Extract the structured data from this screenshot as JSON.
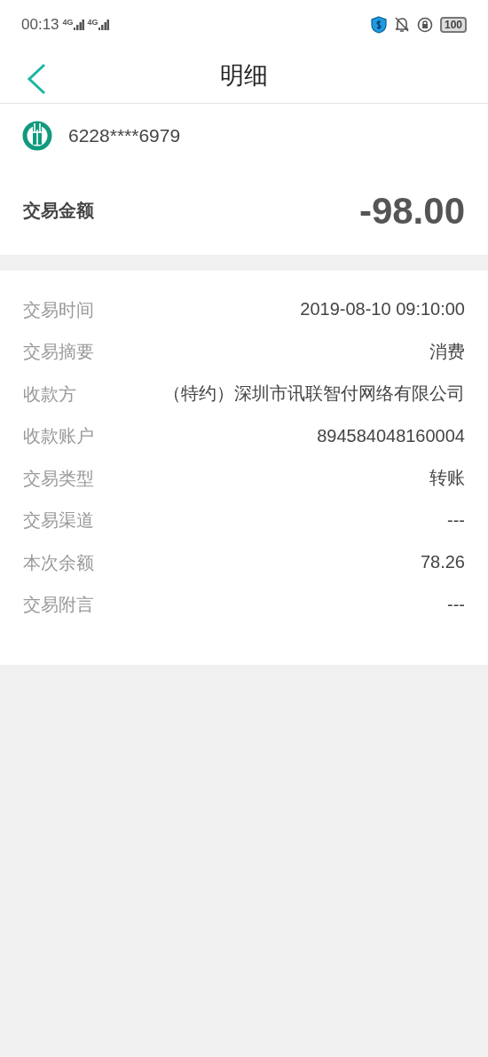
{
  "status_bar": {
    "time": "00:13",
    "signals": [
      "4G",
      "4G"
    ],
    "battery": "100"
  },
  "header": {
    "title": "明细"
  },
  "card": {
    "number": "6228****6979"
  },
  "amount": {
    "label": "交易金额",
    "value": "-98.00"
  },
  "details": [
    {
      "label": "交易时间",
      "value": "2019-08-10 09:10:00"
    },
    {
      "label": "交易摘要",
      "value": "消费"
    },
    {
      "label": "收款方",
      "value": "（特约）深圳市讯联智付网络有限公司"
    },
    {
      "label": "收款账户",
      "value": "894584048160004"
    },
    {
      "label": "交易类型",
      "value": "转账"
    },
    {
      "label": "交易渠道",
      "value": "---"
    },
    {
      "label": "本次余额",
      "value": "78.26"
    },
    {
      "label": "交易附言",
      "value": "---"
    }
  ]
}
